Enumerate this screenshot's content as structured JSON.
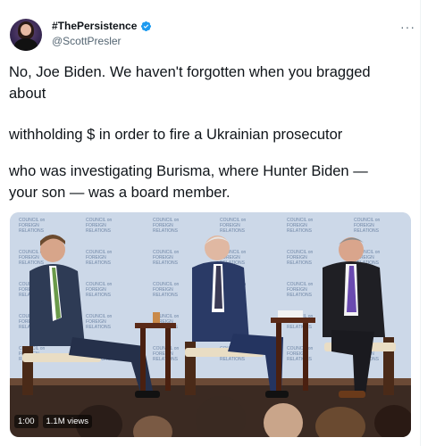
{
  "tweet": {
    "display_name": "#ThePersistence",
    "handle": "@ScottPresler",
    "more_label": "···",
    "lines": [
      "No, Joe Biden. We haven't forgotten when you bragged",
      "about",
      "withholding $ in order to fire a Ukrainian prosecutor",
      "who was investigating Burisma, where Hunter Biden —",
      "your son — was a board member."
    ]
  },
  "media": {
    "backdrop_text": "COUNCIL on FOREIGN RELATIONS",
    "time": "1:00",
    "views": "1.1M views"
  },
  "colors": {
    "verified": "#1d9bf0",
    "backdrop": "#c9d6e6",
    "backdrop_text": "#6f86a6",
    "stage": "#5a3a2a"
  },
  "icons": [
    "verified-badge-icon",
    "more-icon"
  ]
}
